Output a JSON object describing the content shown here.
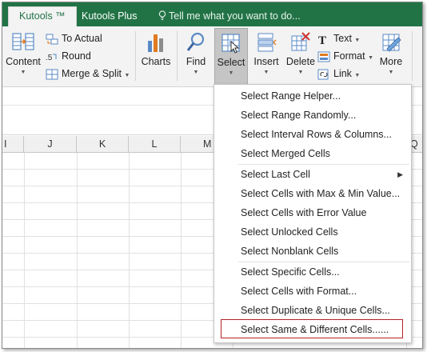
{
  "tabs": [
    {
      "label": "Kutools ™",
      "active": true
    },
    {
      "label": "Kutools Plus",
      "active": false
    }
  ],
  "tellme": "Tell me what you want to do...",
  "ribbon": {
    "content": "Content",
    "to_actual": "To Actual",
    "round": "Round",
    "merge_split": "Merge & Split",
    "charts": "Charts",
    "find": "Find",
    "select": "Select",
    "insert": "Insert",
    "delete": "Delete",
    "text": "Text",
    "format": "Format",
    "link": "Link",
    "more": "More"
  },
  "columns": [
    "I",
    "J",
    "K",
    "L",
    "M",
    "Q"
  ],
  "menu": {
    "items": [
      "Select Range Helper...",
      "Select Range Randomly...",
      "Select Interval Rows & Columns...",
      "Select Merged Cells",
      "Select Last Cell",
      "Select Cells with Max & Min Value...",
      "Select Cells with Error Value",
      "Select Unlocked Cells",
      "Select Nonblank Cells",
      "Select Specific Cells...",
      "Select Cells with Format...",
      "Select Duplicate & Unique Cells...",
      "Select Same & Different Cells......"
    ]
  },
  "colors": {
    "brand": "#217346",
    "highlight_border": "#b22222"
  }
}
